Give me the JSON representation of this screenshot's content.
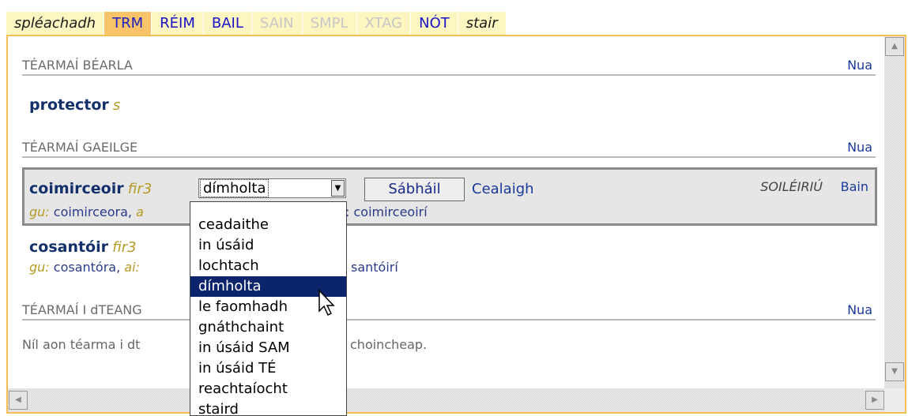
{
  "tabs": [
    {
      "label": "spléachadh",
      "style": "italic"
    },
    {
      "label": "TRM",
      "style": "active"
    },
    {
      "label": "RÉIM",
      "style": "link"
    },
    {
      "label": "BAIL",
      "style": "link"
    },
    {
      "label": "SAIN",
      "style": "disabled"
    },
    {
      "label": "SMPL",
      "style": "disabled"
    },
    {
      "label": "XTAG",
      "style": "disabled"
    },
    {
      "label": "NÓT",
      "style": "link"
    },
    {
      "label": "stair",
      "style": "italic"
    }
  ],
  "english_section": {
    "title": "TÉARMAÍ BÉARLA",
    "new_link": "Nua",
    "term": "protector",
    "pos": "s"
  },
  "irish_section": {
    "title": "TÉARMAÍ GAEILGE",
    "new_link": "Nua",
    "editing_term": {
      "term": "coimirceoir",
      "pos": "fir3",
      "status_select_value": "dímholta",
      "save_button": "Sábháil",
      "cancel_link": "Cealaigh",
      "clarification_label": "SOILÉIRIÚ",
      "delete_link": "Bain",
      "gu_label": "gu:",
      "gu_value": "coimirceora,",
      "ai_label_partial": "a",
      "ai_value_partial": ": coimirceoirí"
    },
    "other_term": {
      "term": "cosantóir",
      "pos": "fir3",
      "gu_label": "gu:",
      "gu_value": "cosantóra,",
      "ai_label": "ai:",
      "ai_value_partial": "santóirí"
    }
  },
  "related_section": {
    "title": "TÉARMAÍ I dTEANG",
    "new_link": "Nua",
    "empty_text_left": "Níl aon téarma i dt",
    "empty_text_right": "choincheap."
  },
  "status_dropdown": {
    "options": [
      "ceadaithe",
      "in úsáid",
      "lochtach",
      "dímholta",
      "le faomhadh",
      "gnáthchaint",
      "in úsáid SAM",
      "in úsáid TÉ",
      "reachtaíocht",
      "staird"
    ],
    "selected_index": 3
  },
  "icons": {
    "scroll_up": "scroll-up-arrow-icon",
    "scroll_down": "scroll-down-arrow-icon",
    "scroll_left": "scroll-left-arrow-icon",
    "scroll_right": "scroll-right-arrow-icon",
    "select_arrow": "chevron-down-icon",
    "cursor": "mouse-pointer-icon"
  },
  "colors": {
    "tab_bg": "#fdf6c0",
    "tab_active": "#f9c36a",
    "panel_border": "#f4bf50",
    "selected_option": "#0b246b"
  }
}
